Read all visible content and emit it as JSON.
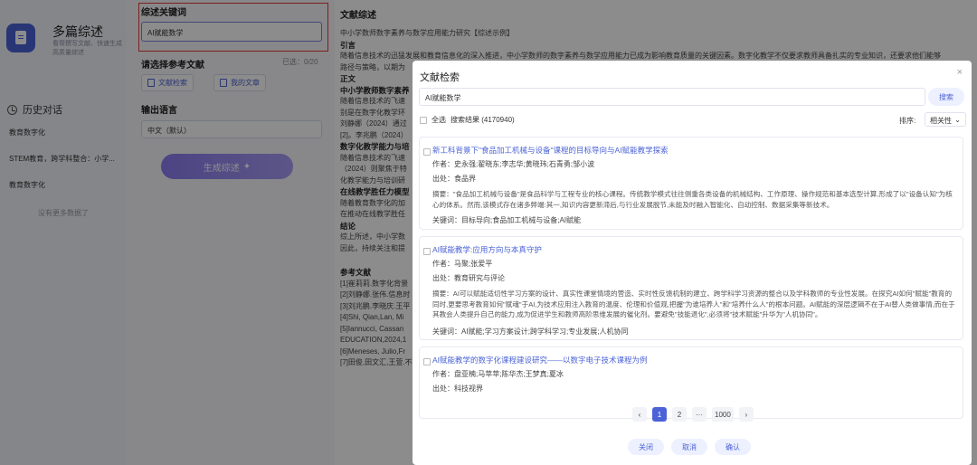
{
  "app": {
    "name": "多篇综述",
    "desc": "看帮撰写文献、快速生成高质量综述"
  },
  "history": {
    "title": "历史对话",
    "items": [
      "教育数字化",
      "STEM教育，跨学科整合：小学...",
      "教育数字化"
    ],
    "empty": "没有更多数据了"
  },
  "form": {
    "keyword_label": "综述关键词",
    "keyword_value": "AI赋能数学",
    "ref_label": "请选择参考文献",
    "selected_count": "已选：0/20",
    "btn_search": "文献检索",
    "btn_mine": "我的文章",
    "lang_label": "输出语言",
    "lang_value": "中文（默认）",
    "generate": "生成综述"
  },
  "review": {
    "title": "文献综述",
    "lines": [
      {
        "text": "中小学数师数字素养与数学应用能力研究【综述示例】",
        "bold": false
      },
      {
        "text": "引言",
        "bold": true
      },
      {
        "text": "随着信息技术的迅猛发展和教育信息化的深入推进，中小学数师的数字素养与数学应用能力已成为影响教育质量的关键因素。数字化教学不仅要求教师具备扎实的专业知识，还要求他们能够",
        "bold": false
      },
      {
        "text": "路径与策略，以期为",
        "bold": false
      },
      {
        "text": "正文",
        "bold": true
      },
      {
        "text": "中小学教师数字素养",
        "bold": true
      },
      {
        "text": "随着信息技术的飞速",
        "bold": false
      },
      {
        "text": "别是在数字化教学环",
        "bold": false
      },
      {
        "text": "刘静娜（2024）通过",
        "bold": false
      },
      {
        "text": "[2]。李兆鹏（2024）",
        "bold": false
      },
      {
        "text": "数字化教学能力与培",
        "bold": true
      },
      {
        "text": "随着信息技术的飞速",
        "bold": false
      },
      {
        "text": "（2024）则聚焦于特",
        "bold": false
      },
      {
        "text": "化教学能力与培训研",
        "bold": false
      },
      {
        "text": "在线教学胜任力模型",
        "bold": true
      },
      {
        "text": "随着教育数字化的加",
        "bold": false
      },
      {
        "text": "在推动在线教学胜任",
        "bold": false
      },
      {
        "text": "结论",
        "bold": true
      },
      {
        "text": "综上所述，中小学数",
        "bold": false
      },
      {
        "text": "因此，持续关注和提",
        "bold": false
      }
    ],
    "refs_title": "参考文献",
    "refs": [
      "[1]崔莉莉.数字化背景",
      "[2]刘静娜.张伟.信息时",
      "[3]刘兆鹏.李晓庆.王平",
      "[4]Shi, Qian,Lan, Mi",
      "[5]Iannucci, Cassan",
      "EDUCATION,2024,1",
      "[6]Meneses, Julio,Fr",
      "[7]田俊,田文汇,王萱.不"
    ]
  },
  "modal": {
    "title": "文献检索",
    "close": "×",
    "search_value": "AI赋能数学",
    "search_btn": "搜索",
    "select_all": "全选",
    "result_count": "搜索结果 (4170940)",
    "sort_label": "排序:",
    "sort_value": "相关性",
    "articles": [
      {
        "title": "新工科背景下\"食品加工机械与设备\"课程的目标导向与AI赋能教学探索",
        "author": "作者：史永强;翟晓东;李志华;黄晓玮;石青勇;邹小波",
        "source": "出处：食品界",
        "abstract": "摘要：\"食品加工机械与设备\"是食品科学与工程专业的核心课程。传统教学模式往往侧重各类设备的机械结构、工作原理、操作规范和基本选型计算,形成了以\"设备认知\"为核心的体系。然而,该模式存在诸多弊端:其一,知识内容更新滞后,与行业发展脱节,未能及时融入智能化、自动控制、数据采集等新技术。",
        "keywords": "关键词：目标导向;食品加工机械与设备;AI赋能"
      },
      {
        "title": "AI赋能教学:应用方向与本真守护",
        "author": "作者：马聚;张爱平",
        "source": "出处：教育研究与评论",
        "abstract": "摘要：AI可以赋能适切性学习方案的设计、真实性课堂情境的营造、实时性反馈机制的建立、跨学科学习资源的整合以及学科教师的专业性发展。在探究AI如何\"赋能\"教育的同时,更要思考教育如何\"赋魂\"于AI,为技术应用注入教育的温度、伦理和价值观,把握\"为谁培养人\"和\"培养什么人\"的根本问题。AI赋能的深层逻辑不在于AI替人类做事情,而在于其教会人类提升自己的能力,成为促进学生和教师高阶思维发展的催化剂。要避免\"技能退化\",必须将\"技术赋能\"升华为\"人机协同\"。",
        "keywords": "关键词：AI赋能;学习方案设计;跨学科学习;专业发展;人机协同"
      },
      {
        "title": "AI赋能教学的数字化课程建设研究——以数字电子技术课程为例",
        "author": "作者：盘亚楠;马苹苹;陈华杰;王梦真;夏冰",
        "source": "出处：科技视界",
        "abstract": "",
        "keywords": ""
      }
    ],
    "pager": [
      "‹",
      "1",
      "2",
      "···",
      "1000",
      "›"
    ],
    "footer": [
      "关闭",
      "取消",
      "确认"
    ]
  }
}
